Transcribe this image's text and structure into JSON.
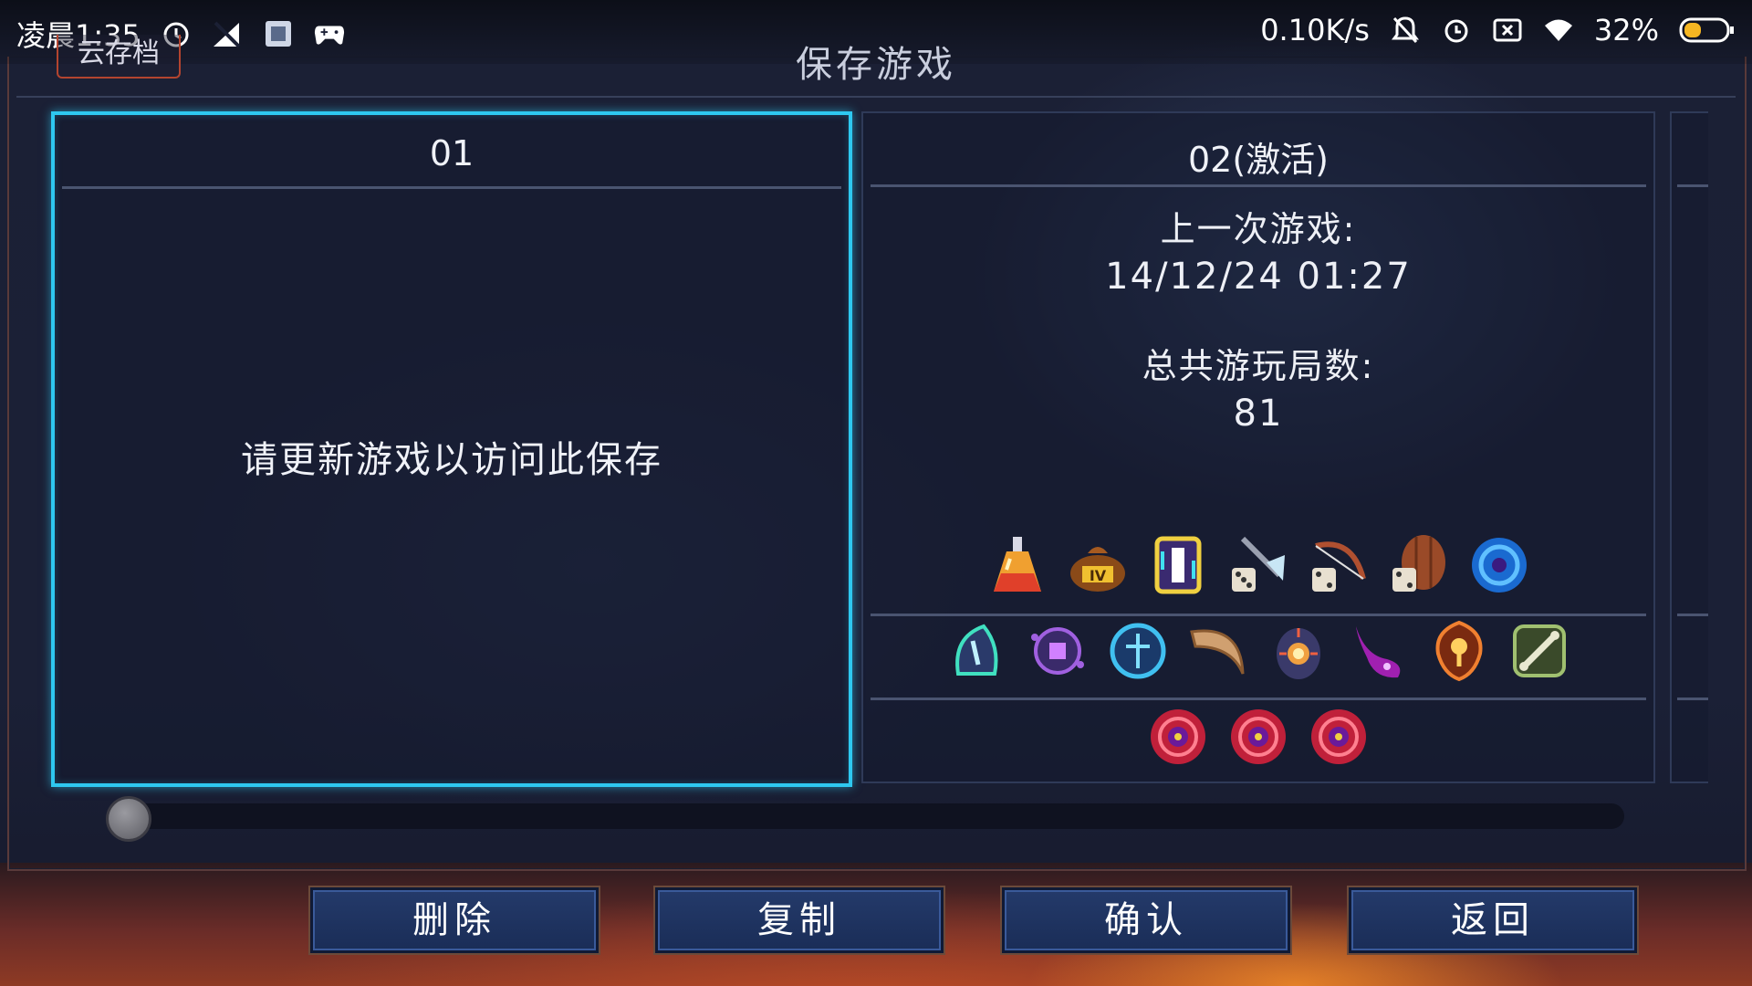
{
  "status_bar": {
    "time": "凌晨1:35",
    "net_speed": "0.10K/s",
    "battery": "32%"
  },
  "cloud_tab": {
    "label": "云存档"
  },
  "page_title": "保存游戏",
  "slots": [
    {
      "title": "01",
      "message": "请更新游戏以访问此保存"
    },
    {
      "title": "02(激活)",
      "last_played_label": "上一次游戏:",
      "last_played_value": "14/12/24 01:27",
      "runs_label": "总共游玩局数:",
      "runs_value": "81",
      "item_rows": [
        [
          "potion-icon",
          "loot-bag-icon",
          "scroll-icon",
          "dice-axe-icon",
          "dice-bow-icon",
          "dice-shield-icon",
          "blue-orb-icon"
        ],
        [
          "green-rune-icon",
          "purple-eye-icon",
          "blue-wheel-icon",
          "horn-icon",
          "fire-lantern-icon",
          "purple-tentacle-icon",
          "orange-rune-icon",
          "bone-tile-icon"
        ],
        [
          "red-eye-amulet-icon",
          "red-eye-amulet-icon",
          "red-eye-amulet-icon"
        ]
      ]
    }
  ],
  "buttons": {
    "delete": "删除",
    "copy": "复制",
    "confirm": "确认",
    "back": "返回"
  },
  "colors": {
    "selected_border": "#2ec8f0",
    "button_bg": "#1f3361",
    "accent_red": "#b3442f"
  }
}
